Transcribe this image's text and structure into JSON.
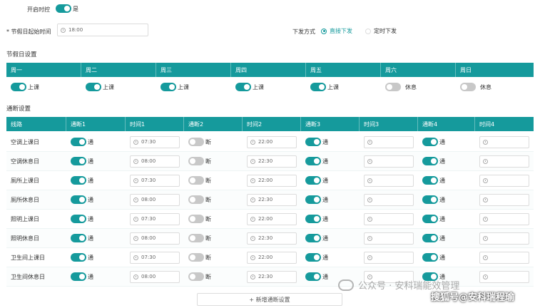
{
  "top": {
    "timer_control_label": "开启时控",
    "timer_control_value": "是",
    "holiday_start_label": "* 节假日起始时间",
    "holiday_start_value": "18:00",
    "dispatch_label": "下发方式",
    "dispatch_options": [
      "直接下发",
      "定时下发"
    ]
  },
  "holiday_section": {
    "title": "节假日设置",
    "days": [
      {
        "day": "周一",
        "state": "上课",
        "on": true
      },
      {
        "day": "周二",
        "state": "上课",
        "on": true
      },
      {
        "day": "周三",
        "state": "上课",
        "on": true
      },
      {
        "day": "周四",
        "state": "上课",
        "on": true
      },
      {
        "day": "周五",
        "state": "上课",
        "on": true
      },
      {
        "day": "周六",
        "state": "休息",
        "on": false
      },
      {
        "day": "周日",
        "state": "休息",
        "on": false
      }
    ]
  },
  "switch_section": {
    "title": "通断设置",
    "headers": [
      "线路",
      "通断1",
      "时间1",
      "通断2",
      "时间2",
      "通断3",
      "时间3",
      "通断4",
      "时间4"
    ],
    "on_label": "通",
    "off_label": "断",
    "rows": [
      {
        "name": "空调上课日",
        "t1": "07:30",
        "t2": "22:00"
      },
      {
        "name": "空调休息日",
        "t1": "08:00",
        "t2": "22:30"
      },
      {
        "name": "厕所上课日",
        "t1": "07:30",
        "t2": "22:00"
      },
      {
        "name": "厕所休息日",
        "t1": "08:00",
        "t2": "22:30"
      },
      {
        "name": "照明上课日",
        "t1": "07:30",
        "t2": "22:00"
      },
      {
        "name": "照明休息日",
        "t1": "08:00",
        "t2": "22:30"
      },
      {
        "name": "卫生间上课日",
        "t1": "07:30",
        "t2": "22:00"
      },
      {
        "name": "卫生间休息日",
        "t1": "08:00",
        "t2": "22:30"
      }
    ],
    "add_button": "+ 新增通断设置"
  },
  "watermark": {
    "line1": "公众号 · 安科瑞能效管理",
    "line2": "搜狐号@安科瑞程瑜"
  },
  "colors": {
    "accent": "#159a9c"
  }
}
